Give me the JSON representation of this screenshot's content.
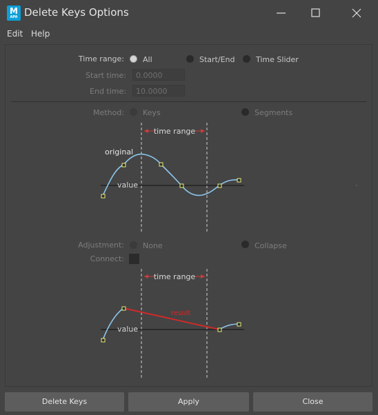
{
  "window": {
    "title": "Delete Keys Options",
    "app_icon_letter": "M",
    "app_icon_sub": "APA"
  },
  "menu": [
    "Edit",
    "Help"
  ],
  "time_range": {
    "label": "Time range:",
    "options": [
      "All",
      "Start/End",
      "Time Slider"
    ],
    "selected": "All"
  },
  "start_time": {
    "label": "Start time:",
    "value": "0.0000"
  },
  "end_time": {
    "label": "End time:",
    "value": "10.0000"
  },
  "method": {
    "label": "Method:",
    "options": [
      "Keys",
      "Segments"
    ]
  },
  "diagram1": {
    "time_range": "time range",
    "original": "original",
    "value": "value"
  },
  "adjustment": {
    "label": "Adjustment:",
    "options": [
      "None",
      "Collapse"
    ]
  },
  "connect": {
    "label": "Connect:",
    "checked": false
  },
  "diagram2": {
    "time_range": "time range",
    "value": "value",
    "result": "result"
  },
  "buttons": {
    "delete": "Delete Keys",
    "apply": "Apply",
    "close": "Close"
  }
}
